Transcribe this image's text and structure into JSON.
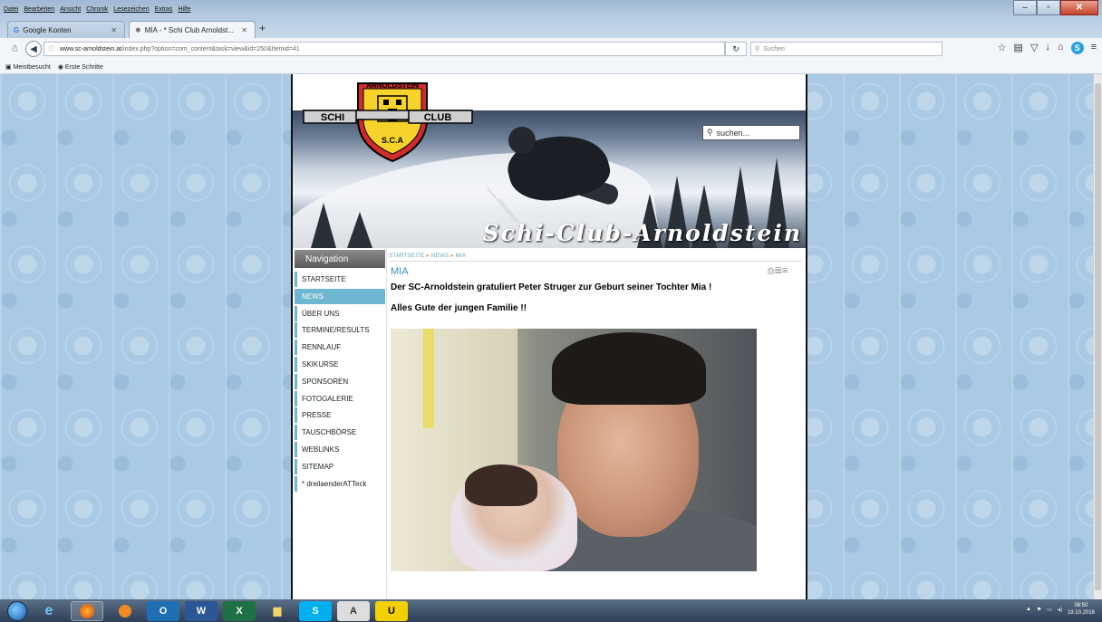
{
  "browser": {
    "menu": [
      "Datei",
      "Bearbeiten",
      "Ansicht",
      "Chronik",
      "Lesezeichen",
      "Extras",
      "Hilfe"
    ],
    "tabs": [
      {
        "label": "Google Konten"
      },
      {
        "label": "MIA - * Schi Club Arnoldst..."
      }
    ],
    "url_domain": "www.sc-arnoldstein.at",
    "url_path": "/index.php?option=com_content&task=view&id=250&Itemid=41",
    "search_placeholder": "Suchen",
    "bookmarks": [
      "Meistbesucht",
      "Erste Schritte"
    ]
  },
  "site": {
    "logo_top": "ARNOLDSTEIN",
    "logo_left": "SCHI",
    "logo_right": "CLUB",
    "logo_bottom": "S.C.A",
    "title": "Schi-Club-Arnoldstein",
    "search_placeholder": "suchen...",
    "nav_heading": "Navigation",
    "nav_items": [
      "STARTSEITE",
      "NEWS",
      "ÜBER UNS",
      "TERMINE/RESULTS",
      "RENNLAUF",
      "SKIKURSE",
      "SPONSOREN",
      "FOTOGALERIE",
      "PRESSE",
      "TAUSCHBÖRSE",
      "WEBLINKS",
      "SITEMAP",
      "* dreilaenderATTeck"
    ],
    "breadcrumb": [
      "STARTSEITE",
      "NEWS",
      "MIA"
    ],
    "article_title": "MIA",
    "article_line1": "Der SC-Arnoldstein gratuliert Peter Struger zur Geburt seiner Tochter Mia !",
    "article_line2": "Alles Gute der jungen Familie !!"
  },
  "taskbar": {
    "time": "08:50",
    "date": "19.10.2016"
  },
  "colors": {
    "accent": "#6fb7d0",
    "title_blue": "#3c8fb5",
    "crumb_sep": "#e2a13a"
  }
}
